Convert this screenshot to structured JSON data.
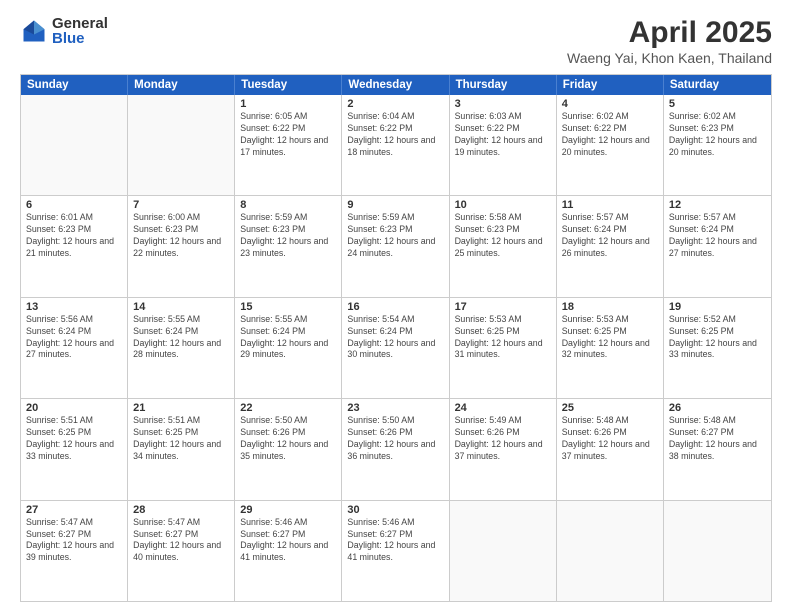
{
  "logo": {
    "general": "General",
    "blue": "Blue"
  },
  "title": "April 2025",
  "subtitle": "Waeng Yai, Khon Kaen, Thailand",
  "headers": [
    "Sunday",
    "Monday",
    "Tuesday",
    "Wednesday",
    "Thursday",
    "Friday",
    "Saturday"
  ],
  "weeks": [
    [
      {
        "day": "",
        "info": ""
      },
      {
        "day": "",
        "info": ""
      },
      {
        "day": "1",
        "info": "Sunrise: 6:05 AM\nSunset: 6:22 PM\nDaylight: 12 hours and 17 minutes."
      },
      {
        "day": "2",
        "info": "Sunrise: 6:04 AM\nSunset: 6:22 PM\nDaylight: 12 hours and 18 minutes."
      },
      {
        "day": "3",
        "info": "Sunrise: 6:03 AM\nSunset: 6:22 PM\nDaylight: 12 hours and 19 minutes."
      },
      {
        "day": "4",
        "info": "Sunrise: 6:02 AM\nSunset: 6:22 PM\nDaylight: 12 hours and 20 minutes."
      },
      {
        "day": "5",
        "info": "Sunrise: 6:02 AM\nSunset: 6:23 PM\nDaylight: 12 hours and 20 minutes."
      }
    ],
    [
      {
        "day": "6",
        "info": "Sunrise: 6:01 AM\nSunset: 6:23 PM\nDaylight: 12 hours and 21 minutes."
      },
      {
        "day": "7",
        "info": "Sunrise: 6:00 AM\nSunset: 6:23 PM\nDaylight: 12 hours and 22 minutes."
      },
      {
        "day": "8",
        "info": "Sunrise: 5:59 AM\nSunset: 6:23 PM\nDaylight: 12 hours and 23 minutes."
      },
      {
        "day": "9",
        "info": "Sunrise: 5:59 AM\nSunset: 6:23 PM\nDaylight: 12 hours and 24 minutes."
      },
      {
        "day": "10",
        "info": "Sunrise: 5:58 AM\nSunset: 6:23 PM\nDaylight: 12 hours and 25 minutes."
      },
      {
        "day": "11",
        "info": "Sunrise: 5:57 AM\nSunset: 6:24 PM\nDaylight: 12 hours and 26 minutes."
      },
      {
        "day": "12",
        "info": "Sunrise: 5:57 AM\nSunset: 6:24 PM\nDaylight: 12 hours and 27 minutes."
      }
    ],
    [
      {
        "day": "13",
        "info": "Sunrise: 5:56 AM\nSunset: 6:24 PM\nDaylight: 12 hours and 27 minutes."
      },
      {
        "day": "14",
        "info": "Sunrise: 5:55 AM\nSunset: 6:24 PM\nDaylight: 12 hours and 28 minutes."
      },
      {
        "day": "15",
        "info": "Sunrise: 5:55 AM\nSunset: 6:24 PM\nDaylight: 12 hours and 29 minutes."
      },
      {
        "day": "16",
        "info": "Sunrise: 5:54 AM\nSunset: 6:24 PM\nDaylight: 12 hours and 30 minutes."
      },
      {
        "day": "17",
        "info": "Sunrise: 5:53 AM\nSunset: 6:25 PM\nDaylight: 12 hours and 31 minutes."
      },
      {
        "day": "18",
        "info": "Sunrise: 5:53 AM\nSunset: 6:25 PM\nDaylight: 12 hours and 32 minutes."
      },
      {
        "day": "19",
        "info": "Sunrise: 5:52 AM\nSunset: 6:25 PM\nDaylight: 12 hours and 33 minutes."
      }
    ],
    [
      {
        "day": "20",
        "info": "Sunrise: 5:51 AM\nSunset: 6:25 PM\nDaylight: 12 hours and 33 minutes."
      },
      {
        "day": "21",
        "info": "Sunrise: 5:51 AM\nSunset: 6:25 PM\nDaylight: 12 hours and 34 minutes."
      },
      {
        "day": "22",
        "info": "Sunrise: 5:50 AM\nSunset: 6:26 PM\nDaylight: 12 hours and 35 minutes."
      },
      {
        "day": "23",
        "info": "Sunrise: 5:50 AM\nSunset: 6:26 PM\nDaylight: 12 hours and 36 minutes."
      },
      {
        "day": "24",
        "info": "Sunrise: 5:49 AM\nSunset: 6:26 PM\nDaylight: 12 hours and 37 minutes."
      },
      {
        "day": "25",
        "info": "Sunrise: 5:48 AM\nSunset: 6:26 PM\nDaylight: 12 hours and 37 minutes."
      },
      {
        "day": "26",
        "info": "Sunrise: 5:48 AM\nSunset: 6:27 PM\nDaylight: 12 hours and 38 minutes."
      }
    ],
    [
      {
        "day": "27",
        "info": "Sunrise: 5:47 AM\nSunset: 6:27 PM\nDaylight: 12 hours and 39 minutes."
      },
      {
        "day": "28",
        "info": "Sunrise: 5:47 AM\nSunset: 6:27 PM\nDaylight: 12 hours and 40 minutes."
      },
      {
        "day": "29",
        "info": "Sunrise: 5:46 AM\nSunset: 6:27 PM\nDaylight: 12 hours and 41 minutes."
      },
      {
        "day": "30",
        "info": "Sunrise: 5:46 AM\nSunset: 6:27 PM\nDaylight: 12 hours and 41 minutes."
      },
      {
        "day": "",
        "info": ""
      },
      {
        "day": "",
        "info": ""
      },
      {
        "day": "",
        "info": ""
      }
    ]
  ]
}
